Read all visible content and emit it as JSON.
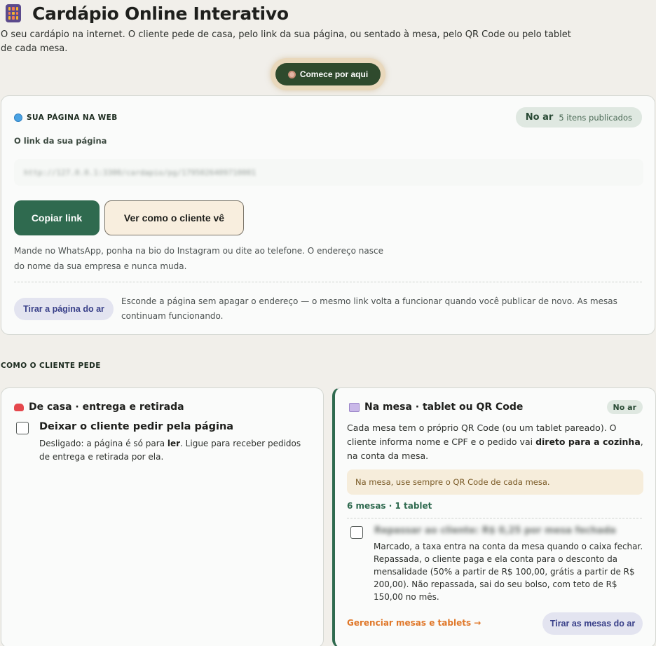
{
  "header": {
    "title": "Cardápio Online Interativo",
    "subtitle": "O seu cardápio na internet. O cliente pede de casa, pelo link da sua página, ou sentado à mesa, pelo QR Code ou pelo tablet de cada mesa.",
    "title_icon": "calculator-grid-icon",
    "start_button": "Comece por aqui",
    "start_icon": "compass-icon"
  },
  "web_page": {
    "section_label": "SUA PÁGINA NA WEB",
    "section_icon": "globe-icon",
    "status": "No ar",
    "published_count": "5 itens publicados",
    "link_label": "O link da sua página",
    "link_value": "http://127.0.0.1:3300/cardapio/pg/1795026409710001",
    "copy_button": "Copiar link",
    "view_button": "Ver como o cliente vê",
    "help_text": "Mande no WhatsApp, ponha na bio do Instagram ou dite ao telefone. O endereço nasce do nome da sua empresa e nunca muda.",
    "unpublish_button": "Tirar a página do ar",
    "unpublish_text": "Esconde a página sem apagar o endereço — o mesmo link volta a funcionar quando você publicar de novo. As mesas continuam funcionando."
  },
  "modes": {
    "heading": "COMO O CLIENTE PEDE",
    "home": {
      "icon": "scooter-icon",
      "title": "De casa · entrega e retirada",
      "option_title": "Deixar o cliente pedir pela página",
      "desc_before": "Desligado: a página é só para ",
      "desc_bold": "ler",
      "desc_after": ". Ligue para receber pedidos de entrega e retirada por ela.",
      "checked": false
    },
    "table": {
      "icon": "plate-icon",
      "title": "Na mesa · tablet ou QR Code",
      "status": "No ar",
      "desc_before": "Cada mesa tem o próprio QR Code (ou um tablet pareado). O cliente informa nome e CPF e o pedido vai ",
      "desc_bold": "direto para a cozinha",
      "desc_after": ", na conta da mesa.",
      "note": "Na mesa, use sempre o QR Code de cada mesa.",
      "count": "6 mesas · 1 tablet",
      "fee_option_label": "Repassar ao cliente: R$ 0,25 por mesa fechada",
      "fee_desc": "Marcado, a taxa entra na conta da mesa quando o caixa fechar. Repassada, o cliente paga e ela conta para o desconto da mensalidade (50% a partir de R$ 100,00, grátis a partir de R$ 200,00). Não repassada, sai do seu bolso, com teto de R$ 150,00 no mês.",
      "fee_checked": false,
      "manage_link": "Gerenciar mesas e tablets →",
      "disable_button": "Tirar as mesas do ar"
    }
  },
  "colors": {
    "primary": "#2f6a4f",
    "background": "#f1efea",
    "accent_orange": "#e0782a"
  }
}
